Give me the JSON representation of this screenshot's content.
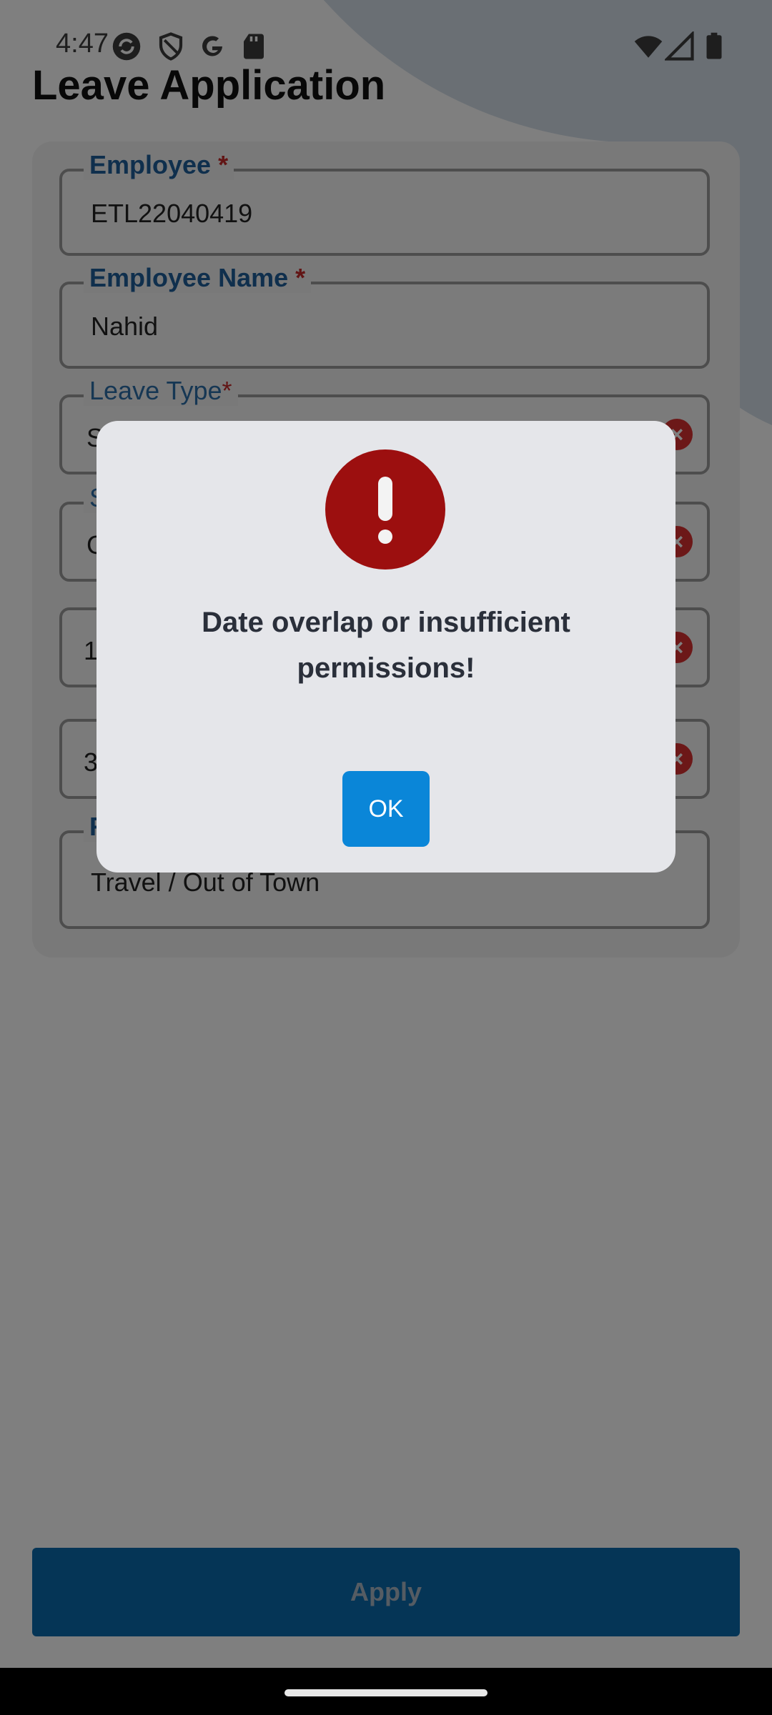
{
  "status_bar": {
    "time": "4:47",
    "left_icons": [
      "sync-icon",
      "shield-icon",
      "google-icon",
      "sd-card-icon"
    ],
    "right_icons": [
      "wifi-icon",
      "cellular-icon",
      "battery-icon"
    ]
  },
  "page": {
    "title": "Leave Application"
  },
  "form": {
    "employee": {
      "label": "Employee",
      "required_mark": "*",
      "value": "ETL22040419"
    },
    "employee_name": {
      "label": "Employee Name",
      "required_mark": "*",
      "value": "Nahid"
    },
    "leave_type": {
      "label": "Leave Type",
      "required_mark": "*",
      "value": "S"
    },
    "field_4": {
      "label": "S",
      "value": "C"
    },
    "field_5": {
      "value": "1"
    },
    "field_6": {
      "value": "3"
    },
    "field_7": {
      "label": "R",
      "value": "Travel / Out of Town"
    },
    "clear_icon": "×"
  },
  "apply_button": {
    "label": "Apply"
  },
  "dialog": {
    "icon": "exclamation-icon",
    "message": "Date overlap or insufficient permissions!",
    "ok_label": "OK"
  },
  "colors": {
    "accent_blue": "#0a86d8",
    "error_red": "#9c0f0f",
    "label_blue": "#1f5f9a",
    "apply_blue": "#0b6aad"
  }
}
